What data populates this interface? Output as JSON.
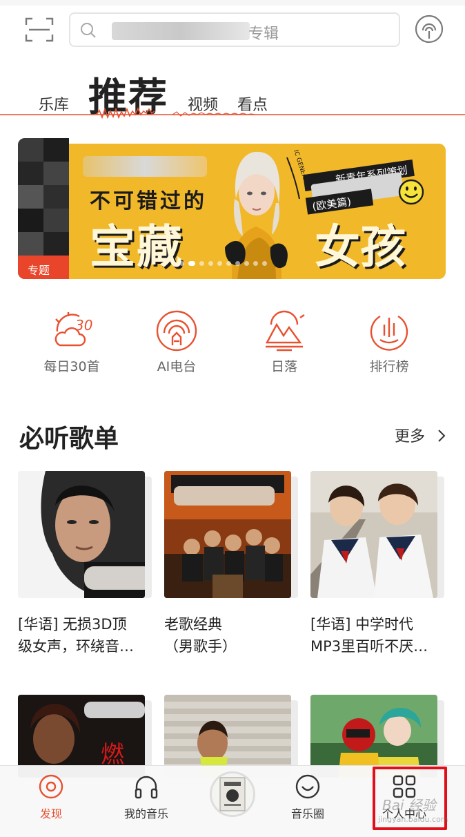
{
  "search": {
    "placeholder": "专辑"
  },
  "tabs": [
    {
      "label": "乐库"
    },
    {
      "label": "推荐"
    },
    {
      "label": "视频"
    },
    {
      "label": "看点"
    }
  ],
  "banner": {
    "side_tag": "专题",
    "line1": "不可错过的",
    "line2a": "宝藏",
    "line2b": "女孩",
    "series_top": "新青年系列策划",
    "series_bottom": "(欧美篇)",
    "ribbon_text": "IC GENERATION",
    "dots_total": 10,
    "dots_active_index": 0
  },
  "quick_entries": [
    {
      "label": "每日30首",
      "icon": "daily-30-icon"
    },
    {
      "label": "AI电台",
      "icon": "ai-radio-icon"
    },
    {
      "label": "日落",
      "icon": "sunset-icon"
    },
    {
      "label": "排行榜",
      "icon": "ranking-icon"
    }
  ],
  "section": {
    "title": "必听歌单",
    "more_label": "更多"
  },
  "playlists": [
    {
      "line1": "[华语] 无损3D顶",
      "line2": "级女声，环绕音…"
    },
    {
      "line1": "老歌经典",
      "line2": "（男歌手）"
    },
    {
      "line1": "[华语] 中学时代",
      "line2": "MP3里百听不厌…"
    }
  ],
  "bottom_nav": [
    {
      "label": "发现",
      "icon": "discover-icon",
      "active": true
    },
    {
      "label": "我的音乐",
      "icon": "headphones-icon",
      "active": false
    },
    {
      "label": "音乐圈",
      "icon": "music-circle-icon",
      "active": false
    },
    {
      "label": "个人中心",
      "icon": "grid-icon",
      "active": false
    }
  ],
  "watermark": {
    "main": "Bai 经验",
    "sub": "jingyan.baidu.com"
  },
  "colors": {
    "accent": "#e8502f",
    "highlight": "#e0101a",
    "banner": "#f1b82a"
  }
}
